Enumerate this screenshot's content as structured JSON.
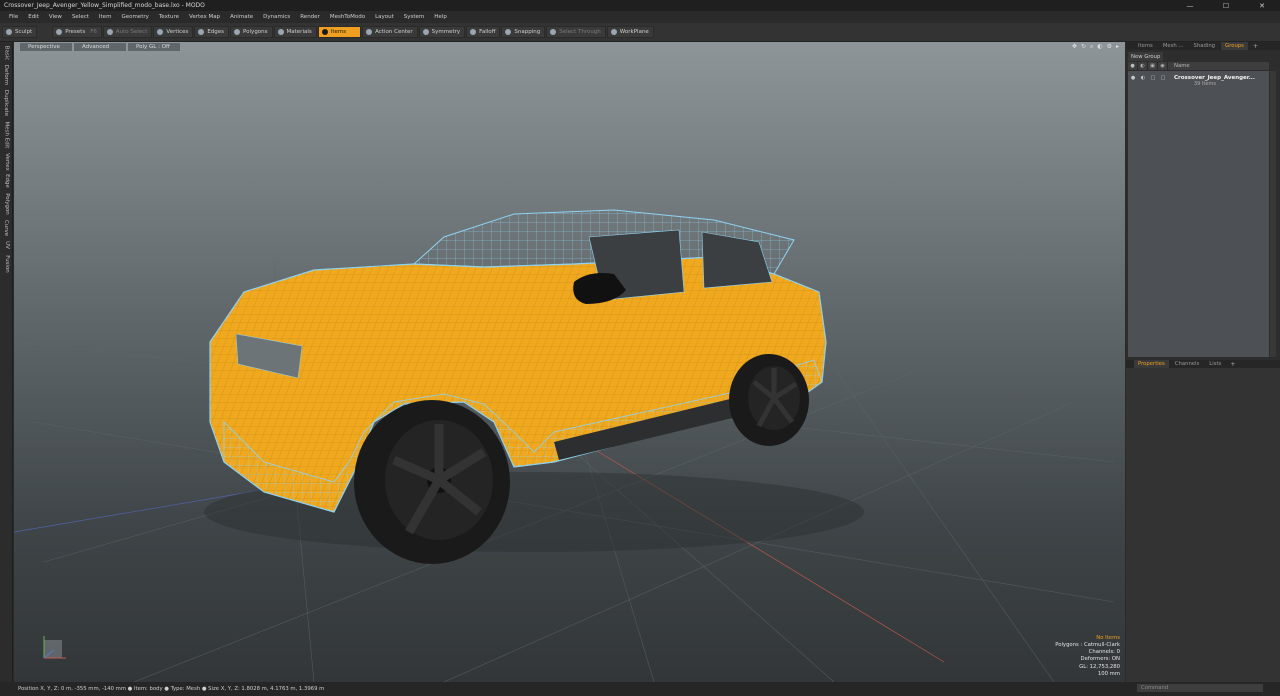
{
  "window": {
    "title": "Crossover_Jeep_Avenger_Yellow_Simplified_modo_base.lxo - MODO",
    "minimize_glyph": "—",
    "maximize_glyph": "☐",
    "close_glyph": "✕"
  },
  "menu": [
    "File",
    "Edit",
    "View",
    "Select",
    "Item",
    "Geometry",
    "Texture",
    "Vertex Map",
    "Animate",
    "Dynamics",
    "Render",
    "MeshToModo",
    "Layout",
    "System",
    "Help"
  ],
  "toolbar": {
    "sculpt": "Sculpt",
    "presets": "Presets",
    "presets_hotkey": "F6",
    "auto_select": "Auto Select",
    "vertices": "Vertices",
    "edges": "Edges",
    "polygons": "Polygons",
    "materials": "Materials",
    "items": "Items",
    "action_center": "Action Center",
    "symmetry": "Symmetry",
    "falloff": "Falloff",
    "snapping": "Snapping",
    "select_through": "Select Through",
    "workplane": "WorkPlane"
  },
  "left_tabs": [
    "Basic",
    "Deform",
    "Duplicate",
    "Mesh Edit",
    "Vertex",
    "Edge",
    "Polygon",
    "Curve",
    "UV",
    "Fusion"
  ],
  "viewport": {
    "view_mode": "Perspective",
    "shading": "Advanced",
    "poly_gl": "Poly GL : Off",
    "icons": [
      "✥",
      "↻",
      "⌕",
      "◐",
      "⚙",
      "▸"
    ],
    "body_color": "#f0a91f",
    "wire_color": "#8fd3f2",
    "info": {
      "selection": "No Items",
      "polygons": "Polygons : Catmull-Clark",
      "channels": "Channels: 0",
      "deformers": "Deformers: ON",
      "gl": "GL: 12,753,280",
      "scale": "100 mm"
    }
  },
  "groups_panel": {
    "tabs": [
      "Items",
      "Mesh ...",
      "Shading",
      "Groups"
    ],
    "active_tab": "Groups",
    "add_glyph": "+",
    "new_group": "New Group",
    "column_name": "Name",
    "item_name": "Crossover_Jeep_Avenger...",
    "item_sub": "39 Items"
  },
  "properties_panel": {
    "tabs": [
      "Properties",
      "Channels",
      "Lists"
    ],
    "add_glyph": "+"
  },
  "command_placeholder": "Command",
  "status": {
    "text": "Position X, Y, Z:   0 m, -355 mm, -140 mm  ●  Item:  body  ●  Type:  Mesh  ●  Size X, Y, Z:   1.8028 m, 4.1763 m, 1.3969 m"
  }
}
